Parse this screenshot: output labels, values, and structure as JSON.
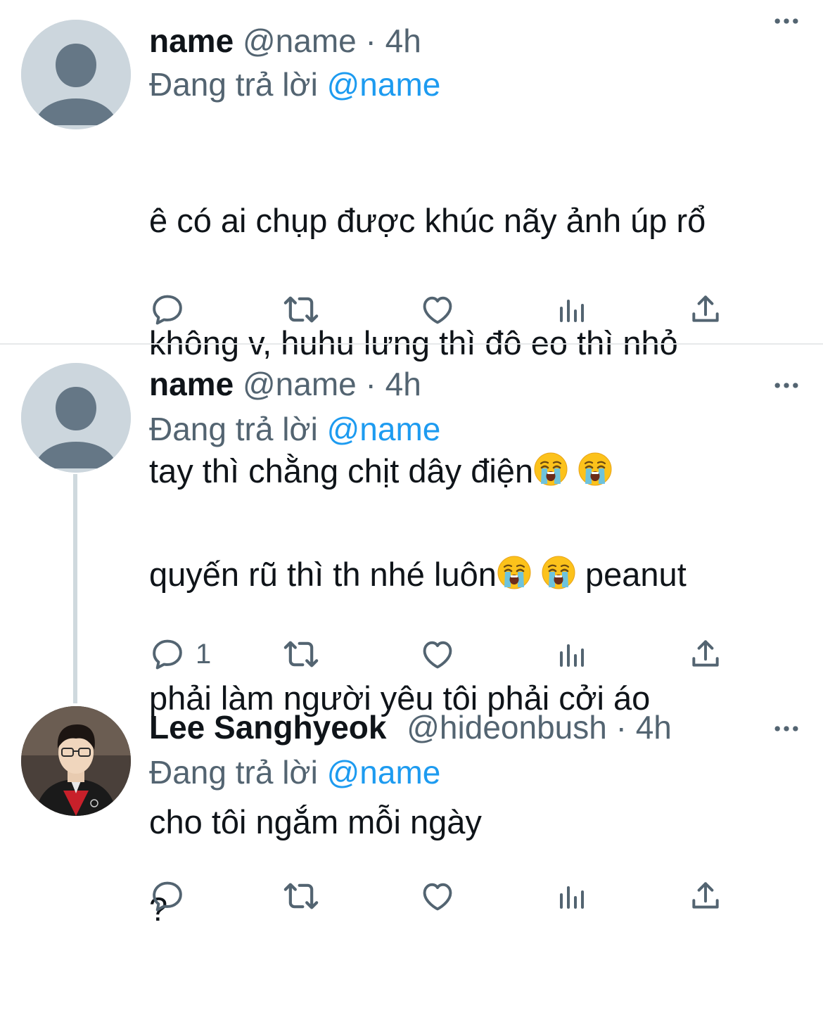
{
  "tweets": [
    {
      "name": "name",
      "handle": "@name",
      "separator": "·",
      "time": "4h",
      "reply_prefix": "Đang trả lời",
      "reply_mention": "@name",
      "text_lines": [
        "ê có ai chụp được khúc nãy ảnh úp rổ",
        "không v, huhu lưng thì đô eo thì nhỏ",
        "tay thì chằng chịt dây điện"
      ],
      "reply_count": ""
    },
    {
      "name": "name",
      "handle": "@name",
      "separator": "·",
      "time": "4h",
      "reply_prefix": "Đang trả lời",
      "reply_mention": "@name",
      "text_lines": [
        "quyến rũ thì th nhé luôn",
        "peanut",
        "phải làm người yêu tôi phải cởi áo",
        "cho tôi ngắm mỗi ngày"
      ],
      "reply_count": "1"
    },
    {
      "name": "Lee Sanghyeok",
      "handle": "@hideonbush",
      "separator": "·",
      "time": "4h",
      "reply_prefix": "Đang trả lời",
      "reply_mention": "@name",
      "text_lines": [
        "?"
      ],
      "reply_count": ""
    }
  ],
  "icons": {
    "more": "more-horizontal-icon",
    "reply": "reply-bubble-icon",
    "retweet": "retweet-icon",
    "like": "heart-icon",
    "analytics": "analytics-bars-icon",
    "share": "share-upload-icon",
    "emoji": "loudly-crying-face-emoji"
  },
  "colors": {
    "text": "#0f1419",
    "secondary": "#536471",
    "link": "#1d9bf0",
    "avatar_placeholder": "#ccd6dd",
    "avatar_silhouette": "#657786"
  }
}
